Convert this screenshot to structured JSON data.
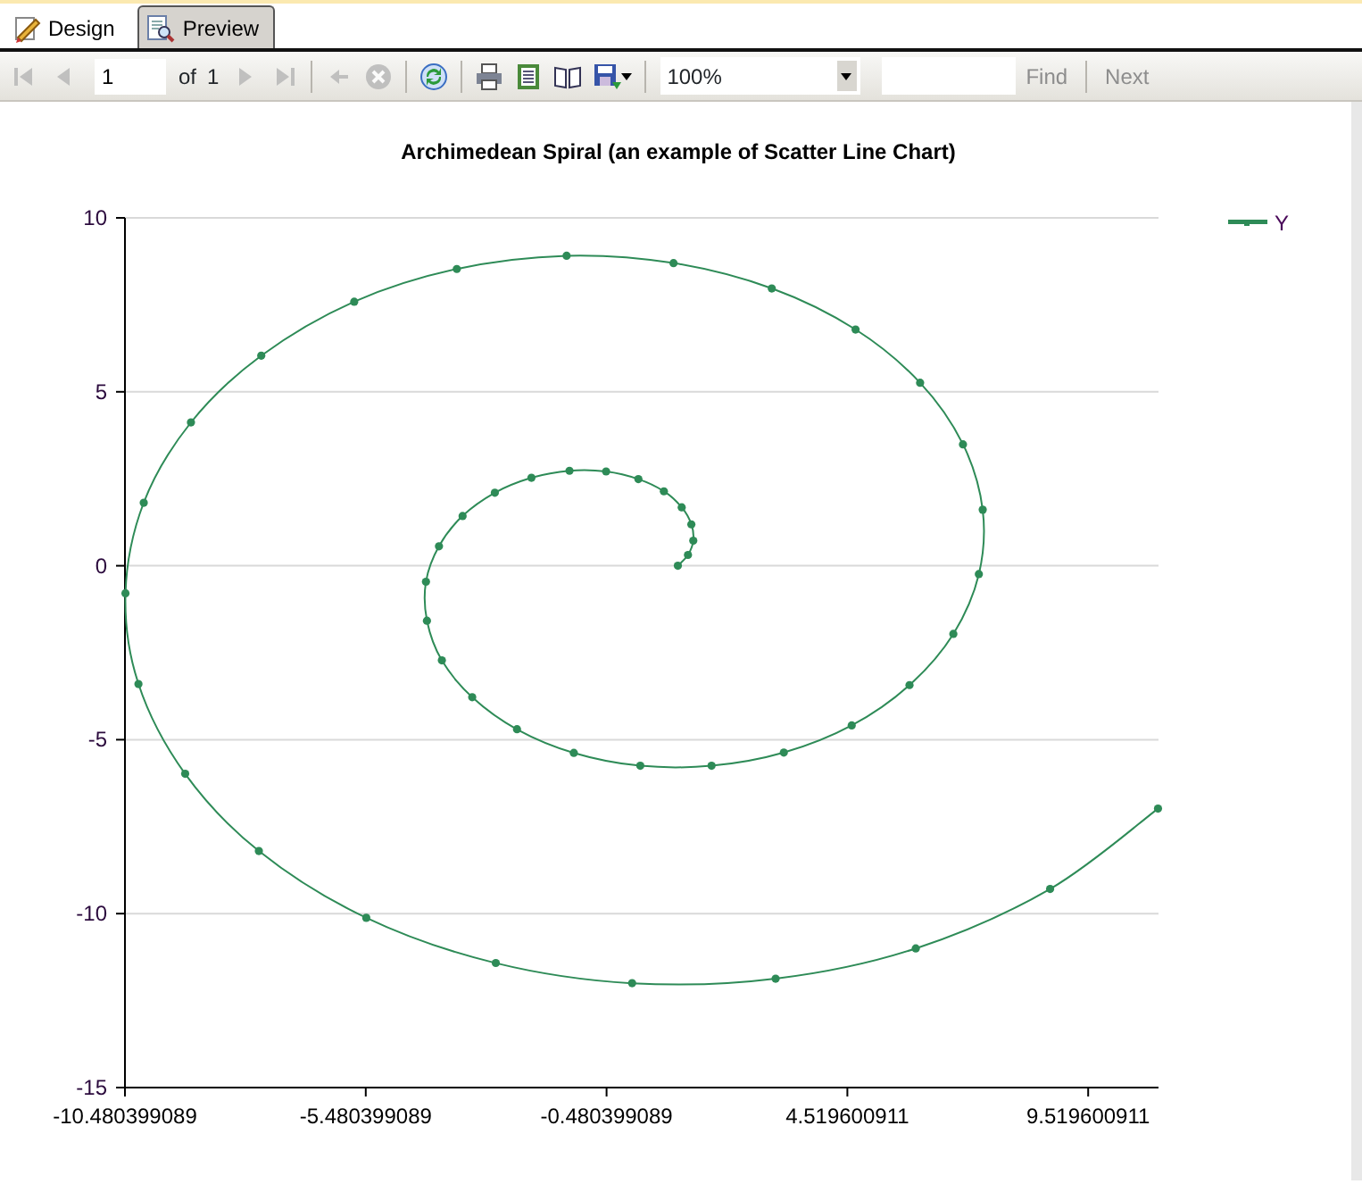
{
  "tabs": [
    {
      "label": "Design",
      "selected": false
    },
    {
      "label": "Preview",
      "selected": true
    }
  ],
  "toolbar": {
    "buttons": [
      {
        "kind": "first",
        "disabled": true
      },
      {
        "kind": "previous",
        "disabled": true
      }
    ],
    "page_number": "1",
    "of_label": "of",
    "page_total": "1",
    "buttons_after": [
      {
        "kind": "next",
        "disabled": true
      },
      {
        "kind": "last",
        "disabled": true
      },
      {
        "kind": "back",
        "disabled": true
      },
      {
        "kind": "stop",
        "disabled": true
      },
      {
        "kind": "refresh",
        "disabled": false
      },
      {
        "kind": "print",
        "disabled": false
      },
      {
        "kind": "layout",
        "disabled": false
      },
      {
        "kind": "page-setup",
        "disabled": false
      },
      {
        "kind": "export",
        "disabled": false
      }
    ],
    "zoom": "100%",
    "find_label": "Find",
    "find_disabled": true,
    "next_label": "Next",
    "next_disabled": true
  },
  "report": {
    "chart_data": {
      "type": "line",
      "title": "Archimedean Spiral (an example of Scatter Line Chart)",
      "grid": true,
      "xlim": [
        -10.480399089,
        10.98
      ],
      "ylim": [
        -15,
        10
      ],
      "xticks": [
        {
          "value": -10.480399089,
          "label": "-10.480399089"
        },
        {
          "value": -5.480399089,
          "label": "-5.480399089"
        },
        {
          "value": -0.480399089,
          "label": "-0.480399089"
        },
        {
          "value": 4.519600911,
          "label": "4.519600911"
        },
        {
          "value": 9.519600911,
          "label": "9.519600911"
        }
      ],
      "yticks": [
        {
          "value": -15,
          "label": "-15"
        },
        {
          "value": -10,
          "label": "-10"
        },
        {
          "value": -5,
          "label": "-5"
        },
        {
          "value": 0,
          "label": "0"
        },
        {
          "value": 5,
          "label": "5"
        },
        {
          "value": 10,
          "label": "10"
        }
      ],
      "x": [
        1,
        1.21,
        1.32,
        1.28,
        1.08,
        0.71,
        0.18,
        -0.49,
        -1.25,
        -2.04,
        -2.8,
        -3.47,
        -3.96,
        -4.23,
        -4.21,
        -3.9,
        -3.27,
        -2.34,
        -1.16,
        0.22,
        1.7,
        3.2,
        4.61,
        5.81,
        6.72,
        7.25,
        7.33,
        6.92,
        6.03,
        4.69,
        2.95,
        0.91,
        -1.31,
        -3.59,
        -5.72,
        -7.65,
        -9.11,
        -10.09,
        -10.47,
        -10.2,
        -9.23,
        -7.7,
        -5.47,
        -2.78,
        0.05,
        3.03,
        5.94,
        8.73,
        10.97
      ],
      "series": [
        {
          "name": "Y",
          "color": "#2e8b57",
          "marker": "circle",
          "values": [
            0,
            0.31,
            0.72,
            1.19,
            1.68,
            2.14,
            2.49,
            2.71,
            2.73,
            2.53,
            2.1,
            1.43,
            0.56,
            -0.46,
            -1.58,
            -2.72,
            -3.78,
            -4.7,
            -5.38,
            -5.75,
            -5.75,
            -5.37,
            -4.59,
            -3.43,
            -1.96,
            -0.24,
            1.61,
            3.49,
            5.26,
            6.79,
            7.97,
            8.7,
            8.91,
            8.53,
            7.59,
            6.04,
            4.12,
            1.81,
            -0.79,
            -3.4,
            -5.98,
            -8.2,
            -10.12,
            -11.42,
            -12,
            -11.87,
            -11,
            -9.29,
            -6.98
          ]
        }
      ]
    }
  }
}
